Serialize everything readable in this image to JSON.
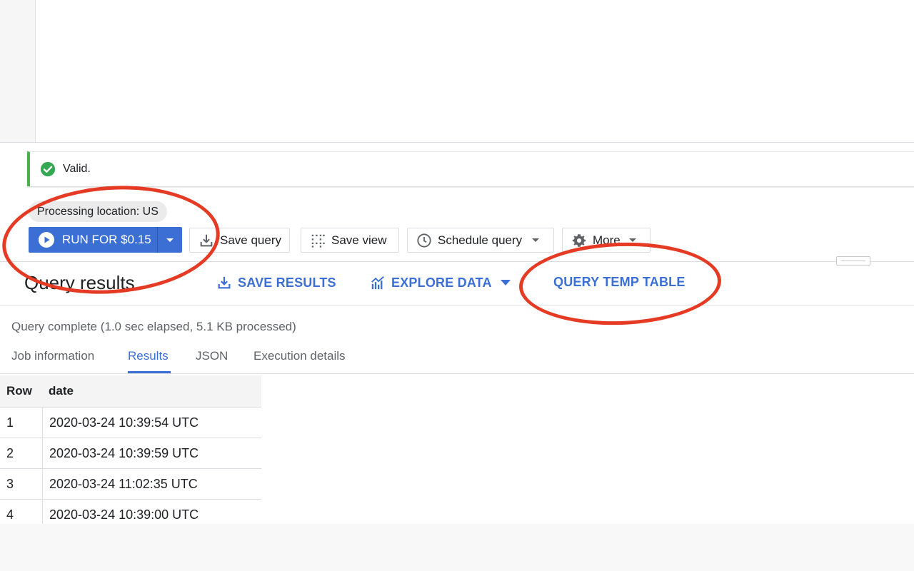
{
  "validation": {
    "text": "Valid."
  },
  "processing_location": "Processing location: US",
  "toolbar": {
    "run_label": "RUN FOR $0.15",
    "save_query": "Save query",
    "save_view": "Save view",
    "schedule_query": "Schedule query",
    "more": "More"
  },
  "results": {
    "title": "Query results",
    "save_results": "SAVE RESULTS",
    "explore_data": "EXPLORE DATA",
    "query_temp_table": "QUERY TEMP TABLE",
    "status": "Query complete (1.0 sec elapsed, 5.1 KB processed)"
  },
  "tabs": [
    {
      "label": "Job information"
    },
    {
      "label": "Results"
    },
    {
      "label": "JSON"
    },
    {
      "label": "Execution details"
    }
  ],
  "table": {
    "columns": [
      "Row",
      "date"
    ],
    "rows": [
      [
        "1",
        "2020-03-24 10:39:54 UTC"
      ],
      [
        "2",
        "2020-03-24 10:39:59 UTC"
      ],
      [
        "3",
        "2020-03-24 11:02:35 UTC"
      ],
      [
        "4",
        "2020-03-24 10:39:00 UTC"
      ]
    ]
  },
  "colors": {
    "accent": "#3b6fd4",
    "valid_green": "#4caf50",
    "annotation_red": "#e53a23"
  },
  "icons": [
    "check-circle-icon",
    "play-icon",
    "download-icon",
    "grid-icon",
    "clock-icon",
    "gear-icon",
    "chart-icon",
    "caret-down-icon"
  ]
}
